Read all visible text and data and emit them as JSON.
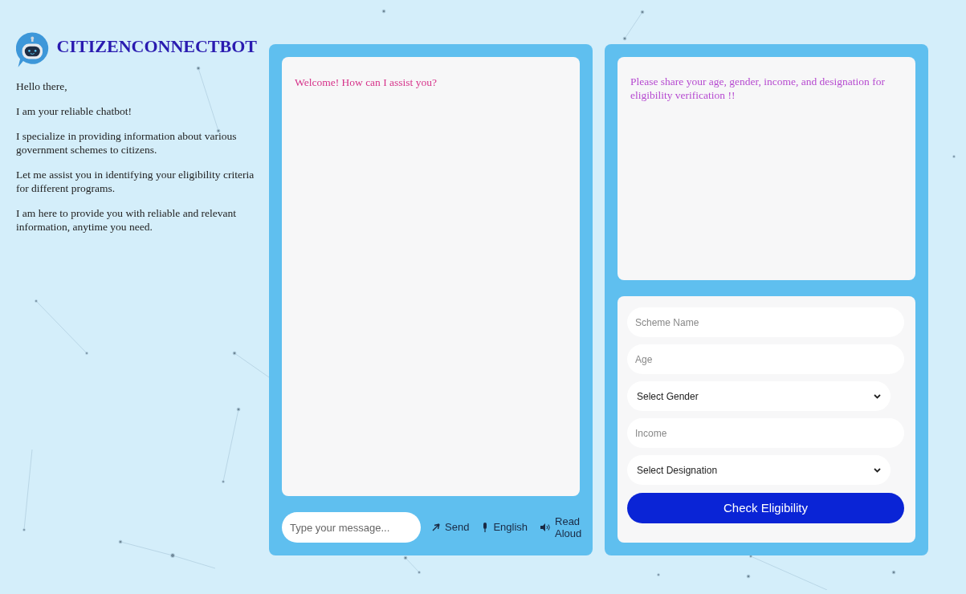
{
  "brand": {
    "title": "CITIZENCONNECTBOT"
  },
  "intro": [
    "Hello there,",
    "I am your reliable chatbot!",
    "I specialize in providing information about various government schemes to citizens.",
    "Let me assist you in identifying your eligibility criteria for different programs.",
    "I am here to provide you with reliable and relevant information, anytime you need."
  ],
  "chat": {
    "messages": [
      "Welcome! How can I assist you?"
    ],
    "input": {
      "placeholder": "Type your message..."
    },
    "actions": [
      {
        "kind": "send",
        "label": "Send"
      },
      {
        "kind": "mic",
        "label": "English"
      },
      {
        "kind": "speaker",
        "label": "Read Aloud"
      }
    ]
  },
  "eligibility": {
    "prompt": "Please share your age, gender, income, and designation for eligibility verification !!",
    "fields": [
      {
        "kind": "input",
        "placeholder": "Scheme Name"
      },
      {
        "kind": "input",
        "placeholder": "Age"
      },
      {
        "kind": "select",
        "value": "Select Gender"
      },
      {
        "kind": "input",
        "placeholder": "Income"
      },
      {
        "kind": "select",
        "value": "Select Designation"
      }
    ],
    "button": "Check Eligibility"
  }
}
